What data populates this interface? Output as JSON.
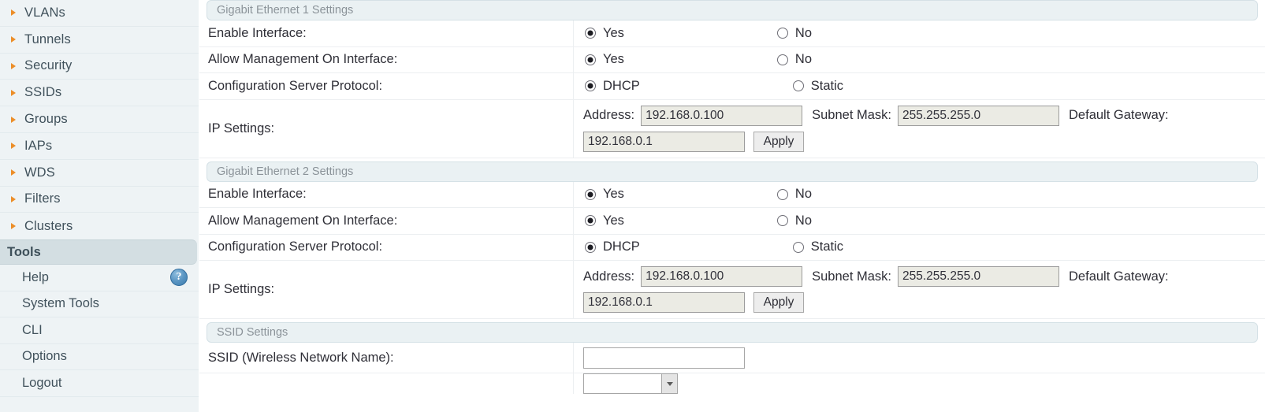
{
  "sidebar": {
    "nav_items": [
      {
        "label": "VLANs",
        "icon": "triangle-right-icon"
      },
      {
        "label": "Tunnels",
        "icon": "triangle-right-icon"
      },
      {
        "label": "Security",
        "icon": "triangle-right-icon"
      },
      {
        "label": "SSIDs",
        "icon": "triangle-right-icon"
      },
      {
        "label": "Groups",
        "icon": "triangle-right-icon"
      },
      {
        "label": "IAPs",
        "icon": "triangle-right-icon"
      },
      {
        "label": "WDS",
        "icon": "triangle-right-icon"
      },
      {
        "label": "Filters",
        "icon": "triangle-right-icon"
      },
      {
        "label": "Clusters",
        "icon": "triangle-right-icon"
      }
    ],
    "tools_header": "Tools",
    "tool_items": [
      {
        "label": "Help",
        "icon": "help-question-icon"
      },
      {
        "label": "System Tools",
        "icon": ""
      },
      {
        "label": "CLI",
        "icon": ""
      },
      {
        "label": "Options",
        "icon": ""
      },
      {
        "label": "Logout",
        "icon": ""
      }
    ],
    "colors": {
      "background": "#eef3f5",
      "bullet": "#ec8e29",
      "text": "#41525c",
      "group_header_bg": "#d3dee2",
      "help_icon": "#5c97c4"
    }
  },
  "content": {
    "sections": [
      {
        "header": "Gigabit Ethernet 1 Settings",
        "rows": [
          {
            "label": "Enable Interface:",
            "type": "radio",
            "options": [
              {
                "label": "Yes",
                "selected": true
              },
              {
                "label": "No",
                "selected": false
              }
            ]
          },
          {
            "label": "Allow Management On Interface:",
            "type": "radio",
            "options": [
              {
                "label": "Yes",
                "selected": true
              },
              {
                "label": "No",
                "selected": false
              }
            ]
          },
          {
            "label": "Configuration Server Protocol:",
            "type": "radio",
            "options": [
              {
                "label": "DHCP",
                "selected": true
              },
              {
                "label": "Static",
                "selected": false
              }
            ]
          },
          {
            "label": "IP Settings:",
            "type": "ip",
            "address_label": "Address:",
            "address_value": "192.168.0.100",
            "subnet_label": "Subnet Mask:",
            "subnet_value": "255.255.255.0",
            "gateway_label": "Default Gateway:",
            "gateway_value": "192.168.0.1",
            "apply_label": "Apply"
          }
        ]
      },
      {
        "header": "Gigabit Ethernet 2 Settings",
        "rows": [
          {
            "label": "Enable Interface:",
            "type": "radio",
            "options": [
              {
                "label": "Yes",
                "selected": true
              },
              {
                "label": "No",
                "selected": false
              }
            ]
          },
          {
            "label": "Allow Management On Interface:",
            "type": "radio",
            "options": [
              {
                "label": "Yes",
                "selected": true
              },
              {
                "label": "No",
                "selected": false
              }
            ]
          },
          {
            "label": "Configuration Server Protocol:",
            "type": "radio",
            "options": [
              {
                "label": "DHCP",
                "selected": true
              },
              {
                "label": "Static",
                "selected": false
              }
            ]
          },
          {
            "label": "IP Settings:",
            "type": "ip",
            "address_label": "Address:",
            "address_value": "192.168.0.100",
            "subnet_label": "Subnet Mask:",
            "subnet_value": "255.255.255.0",
            "gateway_label": "Default Gateway:",
            "gateway_value": "192.168.0.1",
            "apply_label": "Apply"
          }
        ]
      },
      {
        "header": "SSID Settings",
        "rows": [
          {
            "label": "SSID (Wireless Network Name):",
            "type": "text",
            "value": "",
            "placeholder": ""
          },
          {
            "label": "",
            "type": "select",
            "value": ""
          }
        ]
      }
    ],
    "colors": {
      "section_header_bg": "#eaf1f3",
      "section_header_text": "#8b9399",
      "label_text": "#2f2f37",
      "field_bg": "#ebebe4",
      "row_divider": "#eceff1"
    }
  }
}
